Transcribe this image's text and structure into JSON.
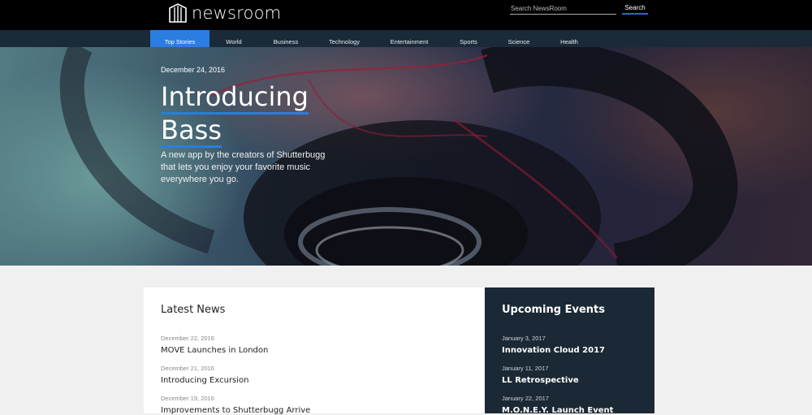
{
  "header": {
    "logo_text": "newsroom",
    "search_placeholder": "Search NewsRoom",
    "search_button": "Search"
  },
  "nav": {
    "items": [
      "Top Stories",
      "World",
      "Business",
      "Technology",
      "Entertainment",
      "Sports",
      "Science",
      "Health"
    ],
    "active": "Top Stories"
  },
  "hero": {
    "date": "December 24, 2016",
    "title_line1": "Introducing",
    "title_line2": "Bass",
    "description": "A new app by the creators of Shutterbugg that lets you enjoy your favorite music everywhere you go."
  },
  "latest_news": {
    "heading": "Latest News",
    "items": [
      {
        "date": "December 22, 2016",
        "title": "MOVE Launches in London"
      },
      {
        "date": "December 21, 2016",
        "title": "Introducing Excursion"
      },
      {
        "date": "December 19, 2016",
        "title": "Improvements to Shutterbugg Arrive"
      }
    ]
  },
  "upcoming_events": {
    "heading": "Upcoming Events",
    "items": [
      {
        "date": "January 3, 2017",
        "title": "Innovation Cloud 2017"
      },
      {
        "date": "January 11, 2017",
        "title": "LL Retrospective"
      },
      {
        "date": "January 22, 2017",
        "title": "M.O.N.E.Y. Launch Event"
      }
    ]
  },
  "colors": {
    "accent": "#2a7de1",
    "nav_bg": "#1a2a38",
    "events_bg": "#1b2835"
  }
}
